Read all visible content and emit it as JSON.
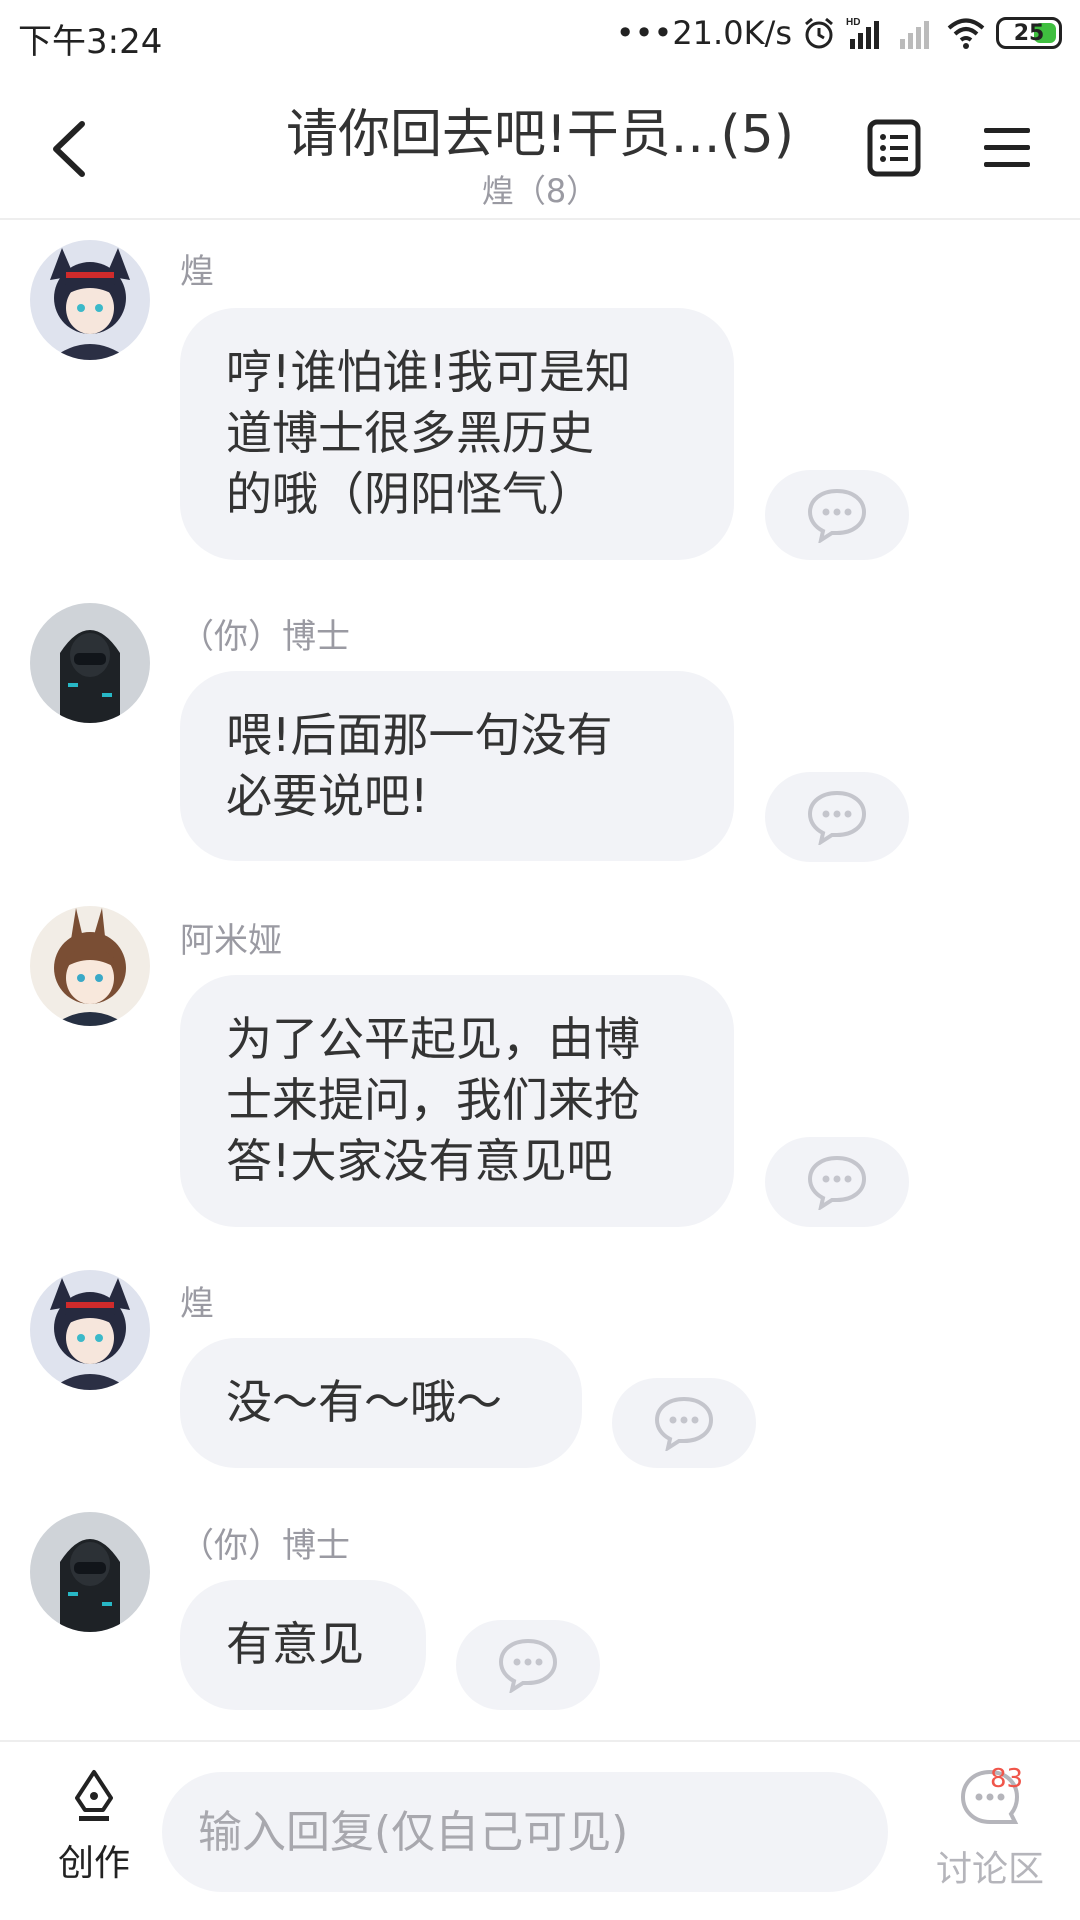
{
  "status_bar": {
    "time": "下午3:24",
    "network_speed": "•••21.0K/s",
    "battery": "25",
    "icons": [
      "alarm-icon",
      "hd-signal-icon",
      "no-signal-icon",
      "wifi-icon",
      "battery-icon"
    ]
  },
  "header": {
    "title": "请你回去吧!干员...(5)",
    "subtitle": "煌（8）",
    "icons": [
      "back-arrow-icon",
      "list-icon",
      "menu-icon"
    ]
  },
  "messages": [
    {
      "name": "煌",
      "text_lines": [
        "哼!谁怕谁!我可是知",
        "道博士很多黑历史",
        "的哦（阴阳怪气）"
      ],
      "avatar": "blaze-avatar"
    },
    {
      "name": "（你）博士",
      "text_lines": [
        "喂!后面那一句没有",
        "必要说吧!"
      ],
      "avatar": "doctor-avatar"
    },
    {
      "name": "阿米娅",
      "text_lines": [
        "为了公平起见，由博",
        "士来提问，我们来抢",
        "答!大家没有意见吧"
      ],
      "avatar": "amiya-avatar"
    },
    {
      "name": "煌",
      "text_lines": [
        "没～有～哦～"
      ],
      "avatar": "blaze-avatar"
    },
    {
      "name": "（你）博士",
      "text_lines": [
        "有意见"
      ],
      "avatar": "doctor-avatar"
    }
  ],
  "bottom_bar": {
    "create_label": "创作",
    "reply_placeholder": "输入回复(仅自己可见)",
    "discuss_label": "讨论区",
    "discuss_count": "83"
  },
  "colors": {
    "bubble_bg": "#f2f3f7",
    "muted_text": "#9a9aa2",
    "badge": "#f0554a",
    "battery_fill": "#3fbf3f"
  }
}
